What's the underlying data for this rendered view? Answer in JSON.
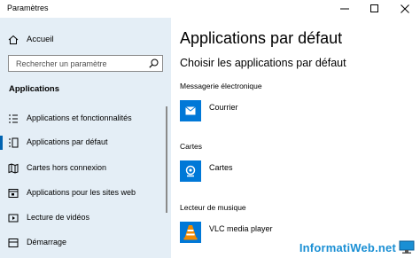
{
  "window": {
    "title": "Paramètres"
  },
  "sidebar": {
    "home_label": "Accueil",
    "search_placeholder": "Rechercher un paramètre",
    "section_title": "Applications",
    "items": [
      {
        "label": "Applications et fonctionnalités",
        "icon": "apps-features-icon",
        "selected": false
      },
      {
        "label": "Applications par défaut",
        "icon": "default-apps-icon",
        "selected": true
      },
      {
        "label": "Cartes hors connexion",
        "icon": "offline-maps-icon",
        "selected": false
      },
      {
        "label": "Applications pour les sites web",
        "icon": "apps-websites-icon",
        "selected": false
      },
      {
        "label": "Lecture de vidéos",
        "icon": "video-playback-icon",
        "selected": false
      },
      {
        "label": "Démarrage",
        "icon": "startup-icon",
        "selected": false
      }
    ]
  },
  "main": {
    "title": "Applications par défaut",
    "subtitle": "Choisir les applications par défaut",
    "categories": [
      {
        "name": "Messagerie électronique",
        "app": "Courrier",
        "icon": "mail-icon"
      },
      {
        "name": "Cartes",
        "app": "Cartes",
        "icon": "maps-icon"
      },
      {
        "name": "Lecteur de musique",
        "app": "VLC media player",
        "icon": "vlc-icon"
      }
    ]
  },
  "watermark": {
    "text": "InformatiWeb.net"
  },
  "colors": {
    "sidebar_bg": "#e4eef6",
    "accent": "#0078d7",
    "selection": "#0063b1"
  }
}
